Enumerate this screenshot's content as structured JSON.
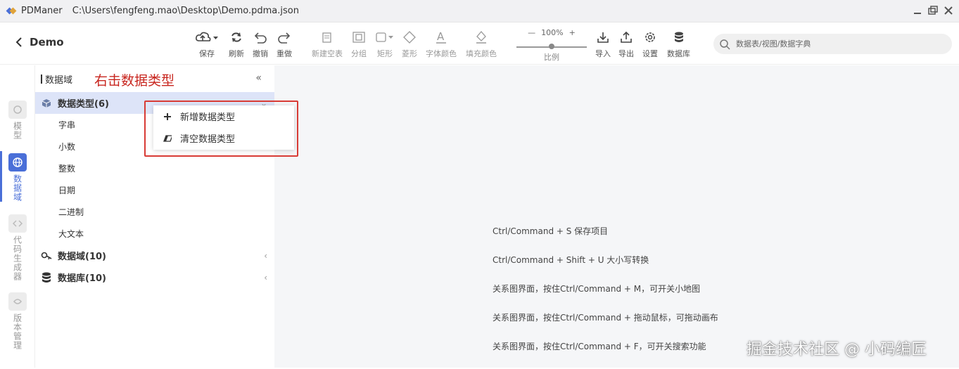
{
  "window": {
    "app_name": "PDManer",
    "file_path": "C:\\Users\\fengfeng.mao\\Desktop\\Demo.pdma.json"
  },
  "header": {
    "back_label": "Demo"
  },
  "toolbar": {
    "save": "保存",
    "refresh": "刷新",
    "undo": "撤销",
    "redo": "重做",
    "new_blank_table": "新建空表",
    "group": "分组",
    "rect": "矩形",
    "shape": "菱形",
    "font_color": "字体颜色",
    "fill_color": "填充颜色",
    "zoom_value": "100%",
    "zoom_label": "比例",
    "import": "导入",
    "export": "导出",
    "settings": "设置",
    "database": "数据库"
  },
  "search": {
    "placeholder": "数据表/视图/数据字典"
  },
  "leftbar": {
    "items": [
      {
        "label": "模型",
        "icon": "model-icon"
      },
      {
        "label": "数据域",
        "icon": "globe-icon"
      },
      {
        "label": "代码生成器",
        "icon": "code-icon"
      },
      {
        "label": "版本管理",
        "icon": "version-icon"
      }
    ]
  },
  "tree": {
    "title": "数据域",
    "annotation": "右击数据类型",
    "collapse_icon": "«",
    "nodes": [
      {
        "label": "数据类型(6)",
        "icon": "cube-icon"
      },
      {
        "label": "数据域(10)",
        "icon": "key-icon"
      },
      {
        "label": "数据库(10)",
        "icon": "database-icon"
      }
    ],
    "datatype_children": [
      "字串",
      "小数",
      "整数",
      "日期",
      "二进制",
      "大文本"
    ]
  },
  "context_menu": {
    "items": [
      {
        "label": "新增数据类型",
        "icon": "plus-icon"
      },
      {
        "label": "清空数据类型",
        "icon": "eraser-icon"
      }
    ]
  },
  "canvas": {
    "tips": [
      "Ctrl/Command + S 保存项目",
      "Ctrl/Command + Shift + U 大小写转换",
      "关系图界面，按住Ctrl/Command + M，可开关小地图",
      "关系图界面，按住Ctrl/Command + 拖动鼠标，可拖动画布",
      "关系图界面，按住Ctrl/Command + F，可开关搜索功能"
    ],
    "watermark": "掘金技术社区 @ 小码编匠"
  },
  "colors": {
    "accent": "#4a6fd8",
    "annotation": "#c8261f",
    "highlight_box": "#d83b35"
  }
}
